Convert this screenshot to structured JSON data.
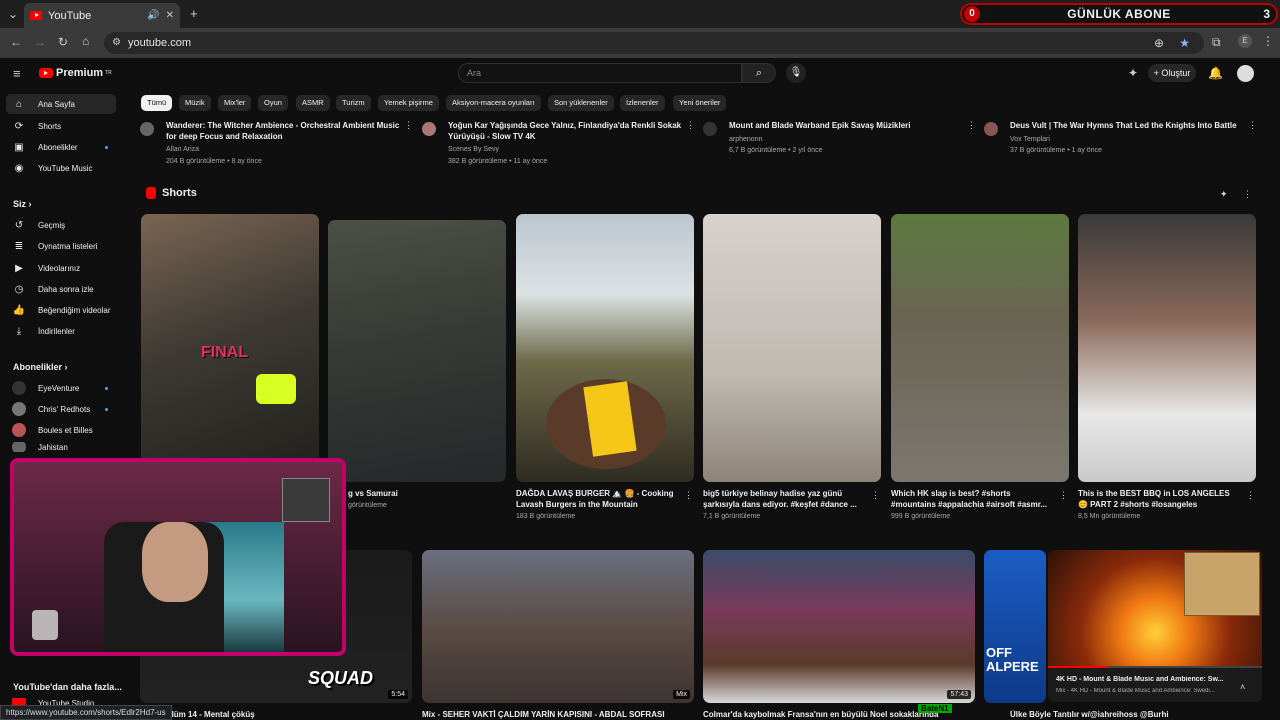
{
  "browser": {
    "tab_title": "YouTube",
    "url": "youtube.com",
    "status_url": "https://www.youtube.com/shorts/Edlr2Hd7-us"
  },
  "abone_overlay": {
    "left_count": "0",
    "label": "GÜNLÜK ABONE",
    "right_count": "3"
  },
  "header": {
    "logo_text": "Premium",
    "logo_sup": "TR",
    "search_placeholder": "Ara",
    "create_label": "Oluştur",
    "avatar_initial": "E"
  },
  "sidebar": {
    "main": [
      {
        "label": "Ana Sayfa",
        "icon": "home-icon"
      },
      {
        "label": "Shorts",
        "icon": "shorts-icon"
      },
      {
        "label": "Abonelikler",
        "icon": "subscriptions-icon"
      },
      {
        "label": "YouTube Music",
        "icon": "music-icon"
      }
    ],
    "you_heading": "Siz",
    "you": [
      {
        "label": "Geçmiş"
      },
      {
        "label": "Oynatma listeleri"
      },
      {
        "label": "Videolarınız"
      },
      {
        "label": "Daha sonra izle"
      },
      {
        "label": "Beğendiğim videolar"
      },
      {
        "label": "İndirilenler"
      }
    ],
    "subs_heading": "Abonelikler",
    "subs": [
      {
        "label": "EyeVenture"
      },
      {
        "label": "Chris' Redhots"
      },
      {
        "label": "Boules et Billes"
      },
      {
        "label": "Jahistan"
      }
    ],
    "more_heading": "YouTube'dan daha fazla...",
    "studio_label": "YouTube Studio"
  },
  "chips": [
    "Tümü",
    "Müzik",
    "Mix'ler",
    "Oyun",
    "ASMR",
    "Turizm",
    "Yemek pişirme",
    "Aksiyon-macera oyunları",
    "Son yüklenenler",
    "İzlenenler",
    "Yeni öneriler"
  ],
  "top_videos": [
    {
      "title": "Wanderer: The Witcher Ambience - Orchestral Ambient Music for deep Focus and Relaxation",
      "channel": "Allan Ariza",
      "meta": "204 B görüntüleme • 8 ay önce"
    },
    {
      "title": "Yoğun Kar Yağışında Gece Yalnız, Finlandiya'da Renkli Sokak Yürüyüşü - Slow TV 4K",
      "channel": "Scenes By Sevy",
      "meta": "382 B görüntüleme • 11 ay önce"
    },
    {
      "title": "Mount and Blade Warband Epik Savaş Müzikleri",
      "channel": "arphenonn",
      "meta": "6,7 B görüntüleme • 2 yıl önce"
    },
    {
      "title": "Deus Vult | The War Hymns That Led the Knights Into Battle",
      "channel": "Vox Templari",
      "meta": "37 B görüntüleme • 1 ay önce"
    }
  ],
  "shorts_heading": "Shorts",
  "shorts": [
    {
      "title": "",
      "views": "",
      "overlay": "FINAL"
    },
    {
      "title": "g vs Samurai",
      "views": "görüntüleme"
    },
    {
      "title": "DAĞDA LAVAŞ BURGER 🏔️ 🍔 - Cooking Lavash Burgers in the Mountain",
      "views": "183 B görüntüleme"
    },
    {
      "title": "big5 türkiye belinay hadise yaz günü şarkısıyla dans ediyor. #keşfet #dance ...",
      "views": "7,1 B görüntüleme"
    },
    {
      "title": "Which HK slap is best? #shorts #mountains #appalachia #airsoft #asmr...",
      "views": "999 B görüntüleme"
    },
    {
      "title": "This is the BEST BBQ in LOS ANGELES 😊 PART 2 #shorts #losangeles",
      "views": "8,5 Mn görüntüleme"
    }
  ],
  "bottom_videos": [
    {
      "title": "uad | Bölüm 14 - Mental çöküş",
      "duration": "5:54",
      "overlay": "SQUAD"
    },
    {
      "title": "Mix - SEHER VAKTİ ÇALDIM YARİN KAPISINI - ABDAL SOFRASI",
      "duration": "Mix"
    },
    {
      "title": "Colmar'da kaybolmak Fransa'nın en büyülü Noel sokaklarında",
      "duration": "57:43"
    },
    {
      "title": "Ülke Böyle Tantılır w/@iahreihoss @Burhi",
      "duration": "",
      "overlay": "OFF ALPERE"
    }
  ],
  "mini_player": {
    "title": "4K HD - Mount & Blade Music and Ambience: Sw...",
    "subtitle": "Mix - 4K HD - Mount & Blade Music and Ambience: Swedi...",
    "tag": "BateN1"
  },
  "colors": {
    "accent": "#ff0000",
    "bg": "#0f0f0f",
    "chip": "#272727",
    "webcam_border": "#c4006a"
  }
}
